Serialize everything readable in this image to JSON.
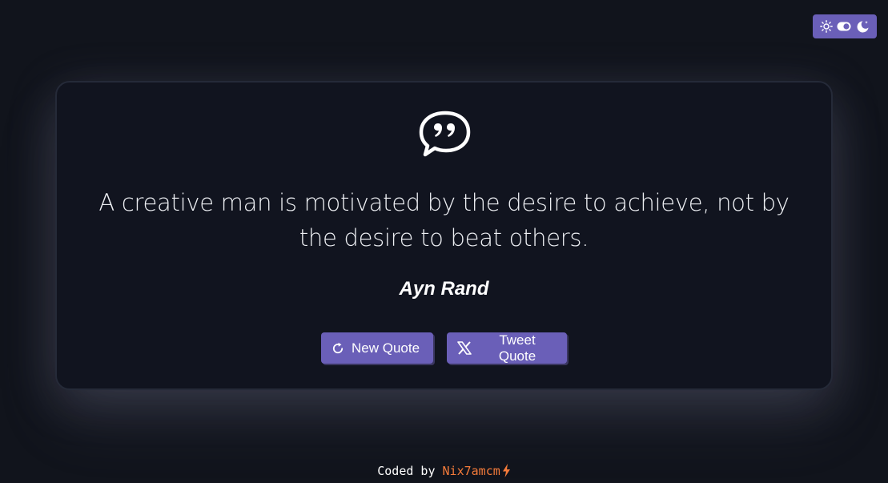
{
  "theme_toggle": {
    "sun_icon": "sun-icon",
    "toggle_icon": "toggle-icon",
    "moon_icon": "moon-icon"
  },
  "card": {
    "quote_icon": "speech-bubble-quote-icon",
    "quote": "A creative man is motivated by the desire to achieve, not by the desire to beat others.",
    "author": "Ayn Rand",
    "buttons": {
      "new_quote": {
        "label": "New Quote",
        "icon": "refresh-icon"
      },
      "tweet_quote": {
        "label": "Tweet Quote",
        "icon": "x-logo-icon"
      }
    }
  },
  "footer": {
    "prefix": "Coded by",
    "author": "Nix7amcm",
    "icon": "lightning-bolt-icon"
  },
  "colors": {
    "background": "#11141c",
    "accent": "#6a5fb8",
    "footer_link": "#f47b3a"
  }
}
